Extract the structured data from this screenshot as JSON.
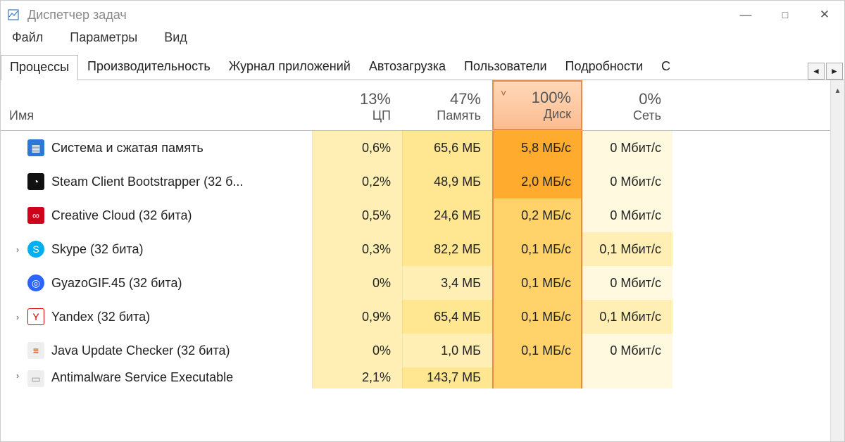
{
  "title": "Диспетчер задач",
  "window_controls": {
    "min": "—",
    "max": "□",
    "close": "✕"
  },
  "menu": [
    "Файл",
    "Параметры",
    "Вид"
  ],
  "tabs": [
    "Процессы",
    "Производительность",
    "Журнал приложений",
    "Автозагрузка",
    "Пользователи",
    "Подробности",
    "С"
  ],
  "active_tab_index": 0,
  "tabscroll": {
    "left": "◄",
    "right": "►"
  },
  "columns": {
    "name_label": "Имя",
    "metrics": [
      {
        "pct": "13%",
        "label": "ЦП",
        "hot": false
      },
      {
        "pct": "47%",
        "label": "Память",
        "hot": false
      },
      {
        "pct": "100%",
        "label": "Диск",
        "hot": true,
        "sort_indicator": "˅"
      },
      {
        "pct": "0%",
        "label": "Сеть",
        "hot": false
      }
    ]
  },
  "rows": [
    {
      "expand": false,
      "icon": "memory-icon",
      "icon_bg": "#2b78d7",
      "icon_glyph": "▦",
      "name": "Система и сжатая память",
      "cpu": {
        "v": "0,6%",
        "h": 1
      },
      "mem": {
        "v": "65,6 МБ",
        "h": 2
      },
      "disk": {
        "v": "5,8 МБ/с",
        "h": 5
      },
      "net": {
        "v": "0 Мбит/с",
        "h": 0
      }
    },
    {
      "expand": false,
      "icon": "steam-icon",
      "icon_bg": "#111",
      "icon_glyph": "◔",
      "name": "Steam Client Bootstrapper (32 б...",
      "cpu": {
        "v": "0,2%",
        "h": 1
      },
      "mem": {
        "v": "48,9 МБ",
        "h": 2
      },
      "disk": {
        "v": "2,0 МБ/с",
        "h": 5
      },
      "net": {
        "v": "0 Мбит/с",
        "h": 0
      }
    },
    {
      "expand": false,
      "icon": "adobe-cc-icon",
      "icon_bg": "#d0021b",
      "icon_glyph": "∞",
      "name": "Creative Cloud (32 бита)",
      "cpu": {
        "v": "0,5%",
        "h": 1
      },
      "mem": {
        "v": "24,6 МБ",
        "h": 2
      },
      "disk": {
        "v": "0,2 МБ/с",
        "h": 3
      },
      "net": {
        "v": "0 Мбит/с",
        "h": 0
      }
    },
    {
      "expand": true,
      "icon": "skype-icon",
      "icon_bg": "#00aff0",
      "icon_glyph": "S",
      "name": "Skype (32 бита)",
      "cpu": {
        "v": "0,3%",
        "h": 1
      },
      "mem": {
        "v": "82,2 МБ",
        "h": 2
      },
      "disk": {
        "v": "0,1 МБ/с",
        "h": 3
      },
      "net": {
        "v": "0,1 Мбит/с",
        "h": 1
      }
    },
    {
      "expand": false,
      "icon": "gyazo-icon",
      "icon_bg": "#2d63ff",
      "icon_glyph": "◎",
      "name": "GyazoGIF.45 (32 бита)",
      "cpu": {
        "v": "0%",
        "h": 1
      },
      "mem": {
        "v": "3,4 МБ",
        "h": 1
      },
      "disk": {
        "v": "0,1 МБ/с",
        "h": 3
      },
      "net": {
        "v": "0 Мбит/с",
        "h": 0
      }
    },
    {
      "expand": true,
      "icon": "yandex-icon",
      "icon_bg": "#fff",
      "icon_glyph": "Y",
      "icon_color": "#d40000",
      "icon_border": "#d40000",
      "name": "Yandex (32 бита)",
      "cpu": {
        "v": "0,9%",
        "h": 1
      },
      "mem": {
        "v": "65,4 МБ",
        "h": 2
      },
      "disk": {
        "v": "0,1 МБ/с",
        "h": 3
      },
      "net": {
        "v": "0,1 Мбит/с",
        "h": 1
      }
    },
    {
      "expand": false,
      "icon": "java-icon",
      "icon_bg": "#eee",
      "icon_glyph": "≡",
      "icon_color": "#c04000",
      "name": "Java Update Checker (32 бита)",
      "cpu": {
        "v": "0%",
        "h": 1
      },
      "mem": {
        "v": "1,0 МБ",
        "h": 1
      },
      "disk": {
        "v": "0,1 МБ/с",
        "h": 3
      },
      "net": {
        "v": "0 Мбит/с",
        "h": 0
      }
    },
    {
      "expand": true,
      "icon": "generic-icon",
      "icon_bg": "#eee",
      "icon_glyph": "▭",
      "icon_color": "#888",
      "name": "Antimalware Service Executable",
      "cpu": {
        "v": "2,1%",
        "h": 1
      },
      "mem": {
        "v": "143,7 МБ",
        "h": 2
      },
      "disk": {
        "v": "",
        "h": 3
      },
      "net": {
        "v": "",
        "h": 0
      },
      "clipped": true
    }
  ],
  "scroll_arrow_up": "▴"
}
